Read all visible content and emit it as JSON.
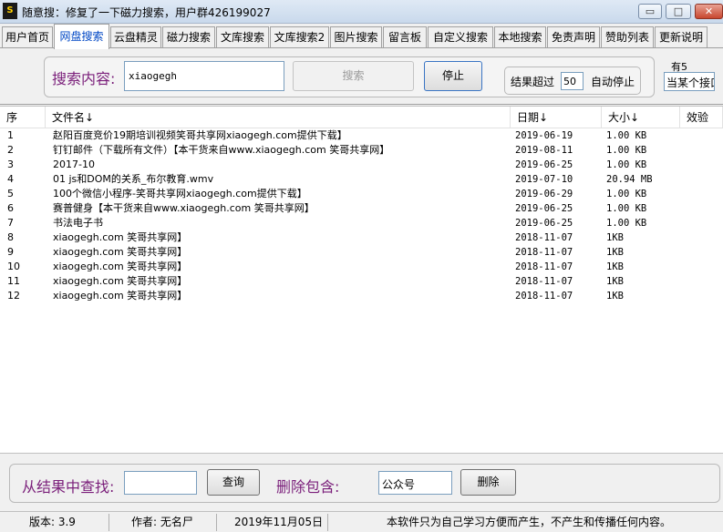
{
  "window": {
    "title": "随意搜：修复了一下磁力搜索，用户群426199027",
    "app_icon_text": "S",
    "controls": {
      "minimize": "▭",
      "maximize": "□",
      "close": "✕"
    }
  },
  "tabs": [
    {
      "label": "用户首页",
      "active": false
    },
    {
      "label": "网盘搜索",
      "active": true
    },
    {
      "label": "云盘精灵",
      "active": false
    },
    {
      "label": "磁力搜索",
      "active": false
    },
    {
      "label": "文库搜索",
      "active": false
    },
    {
      "label": "文库搜索2",
      "active": false
    },
    {
      "label": "图片搜索",
      "active": false
    },
    {
      "label": "留言板",
      "active": false
    },
    {
      "label": "自定义搜索",
      "active": false
    },
    {
      "label": "本地搜索",
      "active": false
    },
    {
      "label": "免责声明",
      "active": false
    },
    {
      "label": "赞助列表",
      "active": false
    },
    {
      "label": "更新说明",
      "active": false
    }
  ],
  "search": {
    "label": "搜索内容:",
    "query": "xiaogegh",
    "search_button": "搜索",
    "stop_button": "停止",
    "exceed_label": "结果超过",
    "exceed_value": "50",
    "exceed_suffix": "自动停止",
    "extra_label": "有5",
    "extra_select": "当某个接口"
  },
  "table": {
    "columns": [
      "序",
      "文件名↓",
      "日期↓",
      "大小↓",
      "效验"
    ],
    "rows": [
      {
        "idx": "1",
        "name": "赵阳百度竞价19期培训视频笑哥共享网xiaogegh.com提供下载】",
        "date": "2019-06-19",
        "size": "1.00 KB"
      },
      {
        "idx": "2",
        "name": "钉钉邮件（下载所有文件）【本干货来自www.xiaogegh.com 笑哥共享网】",
        "date": "2019-08-11",
        "size": "1.00 KB"
      },
      {
        "idx": "3",
        "name": "2017-10",
        "date": "2019-06-25",
        "size": "1.00 KB"
      },
      {
        "idx": "4",
        "name": "01 js和DOM的关系_布尔教育.wmv",
        "date": "2019-07-10",
        "size": "20.94 MB"
      },
      {
        "idx": "5",
        "name": "100个微信小程序-笑哥共享网xiaogegh.com提供下载】",
        "date": "2019-06-29",
        "size": "1.00 KB"
      },
      {
        "idx": "6",
        "name": "赛普健身【本干货来自www.xiaogegh.com 笑哥共享网】",
        "date": "2019-06-25",
        "size": "1.00 KB"
      },
      {
        "idx": "7",
        "name": "书法电子书",
        "date": "2019-06-25",
        "size": "1.00 KB"
      },
      {
        "idx": "8",
        "name": "xiaogegh.com 笑哥共享网】",
        "date": "2018-11-07",
        "size": "1KB"
      },
      {
        "idx": "9",
        "name": "xiaogegh.com 笑哥共享网】",
        "date": "2018-11-07",
        "size": "1KB"
      },
      {
        "idx": "10",
        "name": "xiaogegh.com 笑哥共享网】",
        "date": "2018-11-07",
        "size": "1KB"
      },
      {
        "idx": "11",
        "name": "xiaogegh.com 笑哥共享网】",
        "date": "2018-11-07",
        "size": "1KB"
      },
      {
        "idx": "12",
        "name": "xiaogegh.com 笑哥共享网】",
        "date": "2018-11-07",
        "size": "1KB"
      }
    ]
  },
  "filter": {
    "find_label": "从结果中查找:",
    "find_value": "",
    "query_button": "查询",
    "delete_label": "删除包含:",
    "delete_value": "公众号",
    "delete_button": "删除"
  },
  "status": {
    "version": "版本: 3.9",
    "author": "作者: 无名尸",
    "date": "2019年11月05日",
    "notice": "本软件只为自己学习方便而产生，不产生和传播任何内容。"
  }
}
